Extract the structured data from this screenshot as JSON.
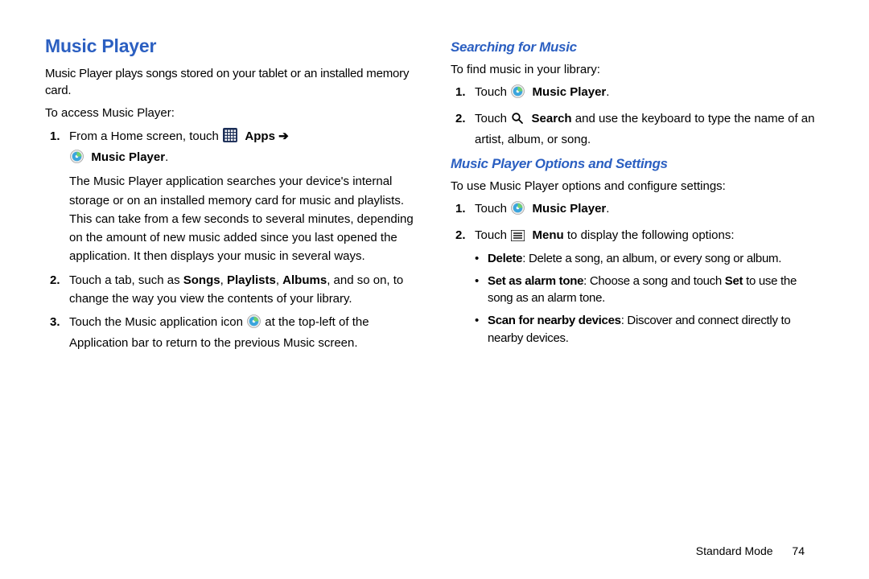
{
  "left": {
    "title": "Music Player",
    "intro": "Music Player plays songs stored on your tablet or an installed memory card.",
    "access": "To access Music Player:",
    "steps": {
      "s1_num": "1.",
      "s1_a": "From a Home screen, touch ",
      "s1_apps": "Apps",
      "s1_arrow": " ➔ ",
      "s1_mp": "Music Player",
      "s1_b": ".",
      "s1_para": "The Music Player application searches your device's internal storage or on an installed memory card for music and playlists. This can take from a few seconds to several minutes, depending on the amount of new music added since you last opened the application. It then displays your music in several ways.",
      "s2_num": "2.",
      "s2_a": "Touch a tab, such as ",
      "s2_songs": "Songs",
      "s2_c1": ", ",
      "s2_playlists": "Playlists",
      "s2_c2": ", ",
      "s2_albums": "Albums",
      "s2_b": ", and so on, to change the way you view the contents of your library.",
      "s3_num": "3.",
      "s3_a": "Touch the Music application icon ",
      "s3_b": " at the top-left of the Application bar to return to the previous Music screen."
    }
  },
  "right": {
    "h_search": "Searching for Music",
    "search_intro": "To find music in your library:",
    "search_steps": {
      "s1_num": "1.",
      "s1_a": "Touch ",
      "s1_mp": "Music Player",
      "s1_b": ".",
      "s2_num": "2.",
      "s2_a": "Touch ",
      "s2_search": "Search",
      "s2_b": " and use the keyboard to type the name of an artist, album, or song."
    },
    "h_options": "Music Player Options and Settings",
    "options_intro": "To use Music Player options and configure settings:",
    "options_steps": {
      "s1_num": "1.",
      "s1_a": "Touch ",
      "s1_mp": "Music Player",
      "s1_b": ".",
      "s2_num": "2.",
      "s2_a": "Touch ",
      "s2_menu": "Menu",
      "s2_b": " to display the following options:"
    },
    "bullets": {
      "b1_label": "Delete",
      "b1_text": ": Delete a song, an album, or every song or album.",
      "b2_label": "Set as alarm tone",
      "b2_text_a": ": Choose a song and touch ",
      "b2_text_set": "Set",
      "b2_text_b": " to use the song as an alarm tone.",
      "b3_label": "Scan for nearby devices",
      "b3_text": ": Discover and connect directly to nearby devices."
    }
  },
  "footer": {
    "mode": "Standard Mode",
    "page": "74"
  }
}
